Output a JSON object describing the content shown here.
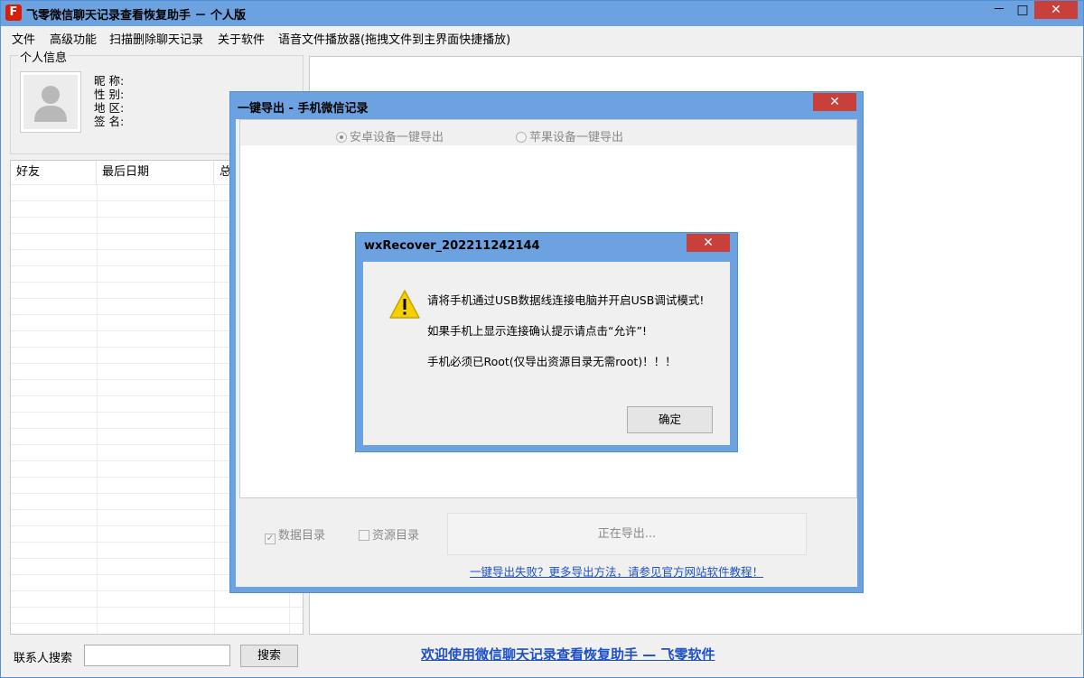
{
  "window": {
    "title": "飞零微信聊天记录查看恢复助手 － 个人版",
    "icon_letter": "F",
    "minimize": "－",
    "maximize": "□",
    "close": "✕"
  },
  "menu": [
    "文件",
    "高级功能",
    "扫描删除聊天记录",
    "关于软件",
    "语音文件播放器(拖拽文件到主界面快捷播放)"
  ],
  "profile": {
    "group_title": "个人信息",
    "fields": [
      "昵 称:",
      "性 别:",
      "地 区:",
      "签 名:"
    ]
  },
  "friend_table": {
    "columns": [
      "好友",
      "最后日期",
      "总"
    ]
  },
  "search": {
    "label": "联系人搜索",
    "value": "",
    "button": "搜索"
  },
  "footer_link": "欢迎使用微信聊天记录查看恢复助手 — 飞零软件",
  "export_dialog": {
    "title": "一键导出 - 手机微信记录",
    "close": "✕",
    "options": [
      {
        "label": "安卓设备一键导出",
        "checked": true
      },
      {
        "label": "苹果设备一键导出",
        "checked": false
      }
    ],
    "checkboxes": [
      {
        "label": "数据目录",
        "checked": true
      },
      {
        "label": "资源目录",
        "checked": false
      }
    ],
    "progress_button": "正在导出...",
    "help_link": "一键导出失败？更多导出方法，请参见官方网站软件教程！"
  },
  "alert": {
    "title": "wxRecover_202211242144",
    "close": "✕",
    "icon": "warning-icon",
    "messages": [
      "请将手机通过USB数据线连接电脑并开启USB调试模式!",
      "如果手机上显示连接确认提示请点击“允许”!",
      "手机必须已Root(仅导出资源目录无需root)！！！"
    ],
    "ok_button": "确定"
  }
}
